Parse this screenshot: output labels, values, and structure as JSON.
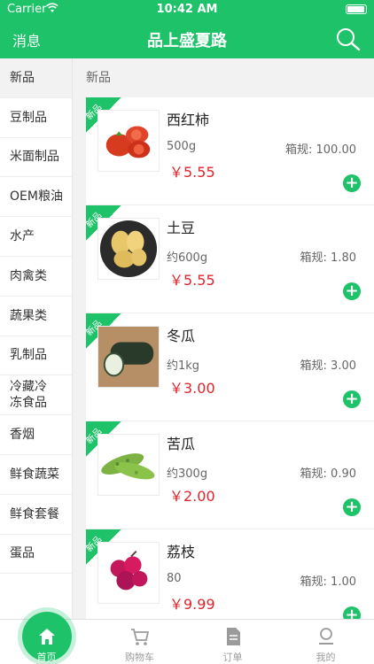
{
  "status": {
    "carrier": "Carrier",
    "time": "10:42 AM",
    "battery_level": 0.95
  },
  "nav": {
    "left_label": "消息",
    "title": "品上盛夏路",
    "search_icon": "search-icon"
  },
  "sidebar": {
    "items": [
      {
        "label": "新品",
        "active": true
      },
      {
        "label": "豆制品"
      },
      {
        "label": "米面制品"
      },
      {
        "label": "OEM粮油"
      },
      {
        "label": "水产"
      },
      {
        "label": "肉禽类"
      },
      {
        "label": "蔬果类"
      },
      {
        "label": "乳制品"
      },
      {
        "label": "冷藏冷\n冻食品"
      },
      {
        "label": "香烟"
      },
      {
        "label": "鲜食蔬菜"
      },
      {
        "label": "鲜食套餐"
      },
      {
        "label": "蛋品"
      }
    ]
  },
  "section": {
    "title": "新品"
  },
  "products": [
    {
      "badge": "新品",
      "name": "西红柿",
      "spec": "500g",
      "box": "箱规: 100.00",
      "price": "￥5.55",
      "image": "tomato"
    },
    {
      "badge": "新品",
      "name": "土豆",
      "spec": "约600g",
      "box": "箱规: 1.80",
      "price": "￥5.55",
      "image": "potato"
    },
    {
      "badge": "新品",
      "name": "冬瓜",
      "spec": "约1kg",
      "box": "箱规: 3.00",
      "price": "￥3.00",
      "image": "winter-melon"
    },
    {
      "badge": "新品",
      "name": "苦瓜",
      "spec": "约300g",
      "box": "箱规: 0.90",
      "price": "￥2.00",
      "image": "bitter-melon"
    },
    {
      "badge": "新品",
      "name": "荔枝",
      "spec": "80",
      "box": "箱规: 1.00",
      "price": "￥9.99",
      "image": "lychee"
    }
  ],
  "tabbar": {
    "items": [
      {
        "label": "首页",
        "icon": "home-icon",
        "active": true
      },
      {
        "label": "购物车",
        "icon": "cart-icon"
      },
      {
        "label": "订单",
        "icon": "order-icon"
      },
      {
        "label": "我的",
        "icon": "profile-icon"
      }
    ]
  },
  "colors": {
    "brand": "#1dc269",
    "price": "#e0252d"
  }
}
